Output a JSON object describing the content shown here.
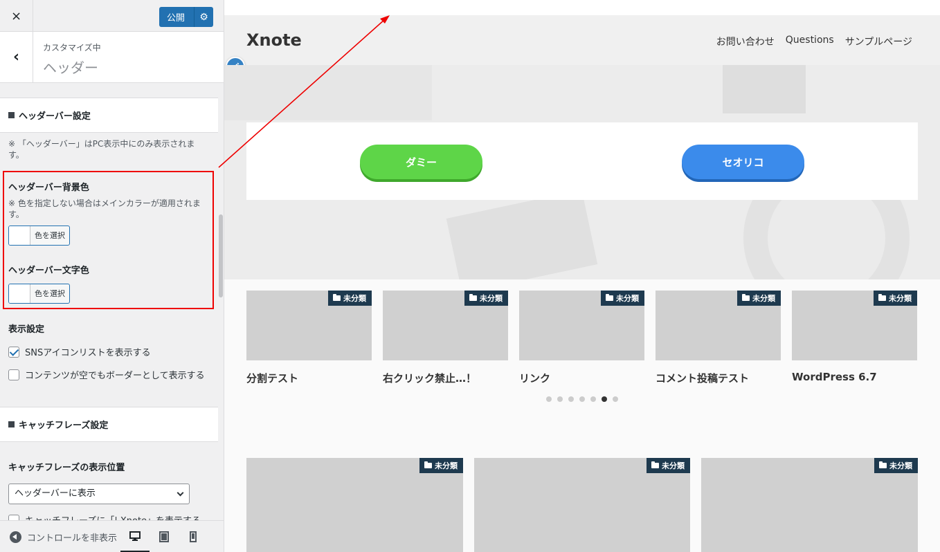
{
  "customizer": {
    "close_icon": "×",
    "publish_label": "公開",
    "gear_icon": "⚙",
    "back_icon": "‹",
    "section_sub": "カスタマイズ中",
    "section_title": "ヘッダー",
    "headerbar_group": "ヘッダーバー設定",
    "headerbar_note": "※ 「ヘッダーバー」はPC表示中にのみ表示されます。",
    "bg_color_label": "ヘッダーバー背景色",
    "bg_color_note": "※ 色を指定しない場合はメインカラーが適用されます。",
    "select_color_label": "色を選択",
    "text_color_label": "ヘッダーバー文字色",
    "display_settings_label": "表示設定",
    "checkbox_sns_label": "SNSアイコンリストを表示する",
    "checkbox_sns_checked": true,
    "checkbox_border_label": "コンテンツが空でもボーダーとして表示する",
    "checkbox_border_checked": false,
    "catchphrase_group": "キャッチフレーズ設定",
    "catchphrase_position_label": "キャッチフレーズの表示位置",
    "catchphrase_position_value": "ヘッダーバーに表示",
    "catchphrase_partial_label": "キャッチフレーズに「| Xnote」を表示する",
    "hide_controls_label": "コントロールを非表示"
  },
  "preview": {
    "site_title": "Xnote",
    "nav": [
      "お問い合わせ",
      "Questions",
      "サンプルページ"
    ],
    "buttons": {
      "green": "ダミー",
      "blue": "セオリコ"
    },
    "category_label": "未分類",
    "posts_row1": [
      "分割テスト",
      "右クリック禁止…！",
      "リンク",
      "コメント投稿テスト",
      "WordPress 6.7"
    ],
    "slider_dots_count": 7,
    "slider_active_dot": 6
  },
  "colors": {
    "accent": "#2271b1",
    "highlight": "#e00000",
    "green_button": "#5ed548",
    "blue_button": "#3b8beb",
    "category_badge": "#1e3a4f"
  }
}
